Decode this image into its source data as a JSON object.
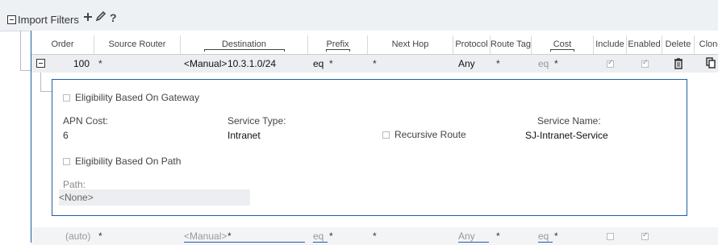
{
  "section": {
    "title": "Import Filters",
    "add_icon": "plus-icon",
    "edit_icon": "pencil-icon",
    "help_label": "?"
  },
  "columns": [
    {
      "label": "Order"
    },
    {
      "label": "Source Router"
    },
    {
      "label": "Destination"
    },
    {
      "label": "Prefix"
    },
    {
      "label": "Next Hop"
    },
    {
      "label": "Protocol"
    },
    {
      "label": "Route Tag"
    },
    {
      "label": "Cost"
    },
    {
      "label": "Include"
    },
    {
      "label": "Enabled"
    },
    {
      "label": "Delete"
    },
    {
      "label": "Clone"
    }
  ],
  "rows": [
    {
      "order": "100",
      "source_router": "*",
      "destination_mode": "<Manual>",
      "destination_value": "10.3.1.0/24",
      "prefix_op": "eq",
      "prefix_value": "*",
      "next_hop": "*",
      "protocol": "Any",
      "route_tag": "*",
      "cost_op": "eq",
      "cost_value": "*",
      "include": true,
      "enabled": true
    },
    {
      "order": "(auto)",
      "source_router": "*",
      "destination_mode": "<Manual>",
      "destination_value": "*",
      "prefix_op": "eq",
      "prefix_value": "*",
      "next_hop": "*",
      "protocol": "Any",
      "route_tag": "*",
      "cost_op": "eq",
      "cost_value": "*",
      "include": false,
      "enabled": true
    }
  ],
  "detail": {
    "eligibility_gateway_label": "Eligibility Based On Gateway",
    "apn_cost_label": "APN Cost:",
    "apn_cost_value": "6",
    "service_type_label": "Service Type:",
    "service_type_value": "Intranet",
    "recursive_route_label": "Recursive Route",
    "service_name_label": "Service Name:",
    "service_name_value": "SJ-Intranet-Service",
    "eligibility_path_label": "Eligibility Based On Path",
    "path_label": "Path:",
    "path_value": "<None>"
  },
  "colors": {
    "accent": "#1f5fa8",
    "row_bg": "#eceef1",
    "band_bg": "#eef1f4"
  }
}
